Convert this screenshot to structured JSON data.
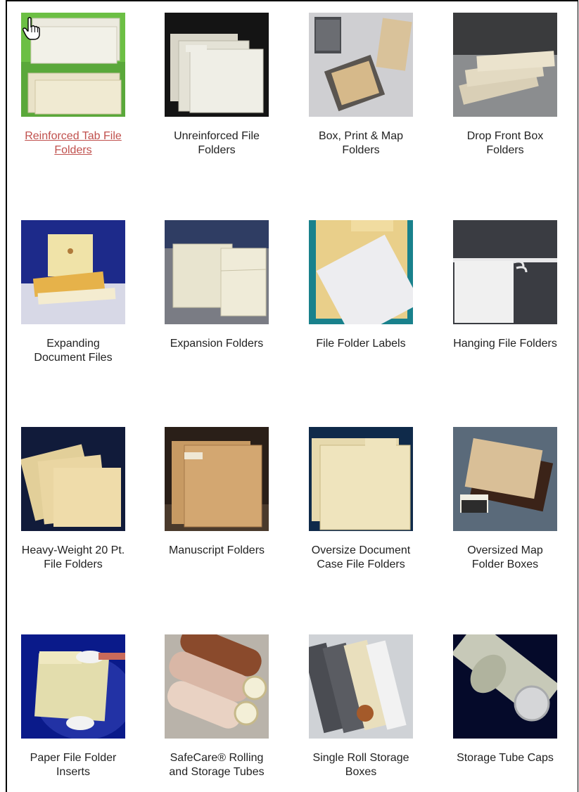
{
  "products": [
    {
      "label": "Reinforced Tab File\nFolders",
      "image": "manila-folders-on-green",
      "active": true
    },
    {
      "label": "Unreinforced File\nFolders",
      "image": "stacked-manila-folders-dark"
    },
    {
      "label": "Box, Print & Map\nFolders",
      "image": "open-boxes-with-prints"
    },
    {
      "label": "Drop Front Box\nFolders",
      "image": "stacked-drop-front-boxes"
    },
    {
      "label": "Expanding\nDocument Files",
      "image": "expanding-file-with-tie"
    },
    {
      "label": "Expansion Folders",
      "image": "expansion-folders-standing"
    },
    {
      "label": "File Folder Labels",
      "image": "folder-with-labels-teal"
    },
    {
      "label": "Hanging File Folders",
      "image": "hanging-folder-hooks"
    },
    {
      "label": "Heavy-Weight 20 Pt.\nFile Folders",
      "image": "fanned-manila-folders"
    },
    {
      "label": "Manuscript Folders",
      "image": "kraft-manuscript-folder"
    },
    {
      "label": "Oversize Document\nCase File Folders",
      "image": "large-manila-folders"
    },
    {
      "label": "Oversized Map\nFolder Boxes",
      "image": "map-boxes-stacked"
    },
    {
      "label": "Paper File Folder\nInserts",
      "image": "gloved-hands-folder"
    },
    {
      "label": "SafeCare® Rolling\nand Storage Tubes",
      "image": "rolled-tubes"
    },
    {
      "label": "Single Roll Storage\nBoxes",
      "image": "long-roll-boxes"
    },
    {
      "label": "Storage Tube Caps",
      "image": "tube-with-cap"
    }
  ],
  "colors": {
    "link_active": "#c0504d",
    "caption": "#222222"
  }
}
